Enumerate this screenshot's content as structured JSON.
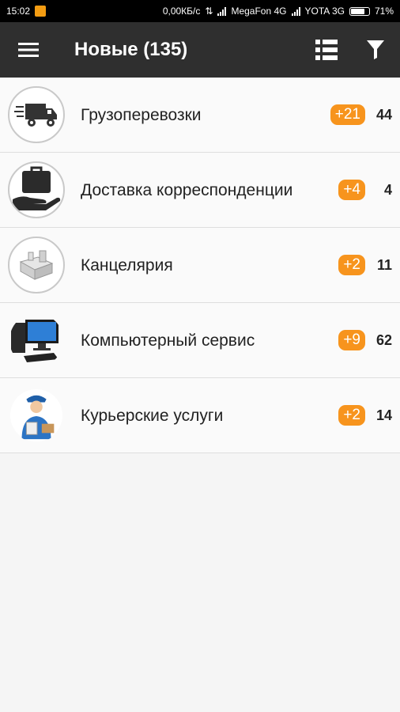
{
  "status_bar": {
    "time": "15:02",
    "speed": "0,00КБ/с",
    "carrier1": "MegaFon 4G",
    "carrier2": "YOTA 3G",
    "battery": "71%"
  },
  "toolbar": {
    "title": "Новые (135)",
    "menu_icon": "hamburger-menu-icon",
    "list_icon": "list-view-icon",
    "filter_icon": "filter-funnel-icon"
  },
  "categories": [
    {
      "label": "Грузоперевозки",
      "badge": "+21",
      "count": "44",
      "icon": "truck-icon"
    },
    {
      "label": "Доставка корреспонденции",
      "badge": "+4",
      "count": "4",
      "icon": "hand-box-icon"
    },
    {
      "label": "Канцелярия",
      "badge": "+2",
      "count": "11",
      "icon": "stationery-icon"
    },
    {
      "label": "Компьютерный сервис",
      "badge": "+9",
      "count": "62",
      "icon": "computer-icon"
    },
    {
      "label": "Курьерские услуги",
      "badge": "+2",
      "count": "14",
      "icon": "courier-icon"
    }
  ],
  "colors": {
    "toolbar": "#2f2f2f",
    "badge": "#f7941d",
    "statusbar": "#000000"
  }
}
